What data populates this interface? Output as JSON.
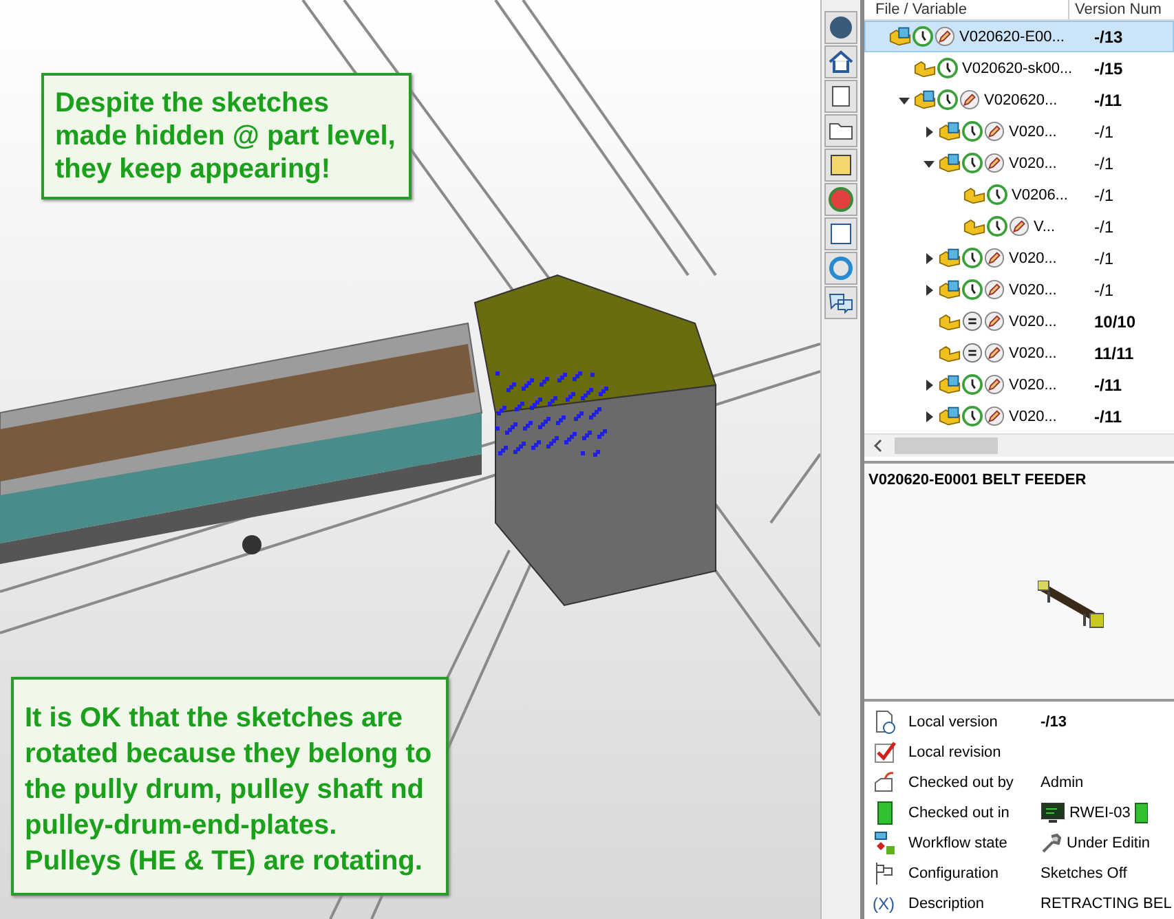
{
  "annotations": [
    {
      "text": "Despite the sketches\nmade hidden @ part level,\nthey keep appearing!"
    },
    {
      "text": "It is OK that the sketches are\nrotated because they belong to\nthe pully drum, pulley shaft nd\npulley-drum-end-plates.\nPulleys (HE & TE) are rotating."
    }
  ],
  "file_tree": {
    "columns": [
      "File / Variable",
      "Version Num"
    ],
    "items": [
      {
        "kind": "assembly",
        "local_only": true,
        "editable": true,
        "name": "V020620-E00...",
        "version": "-/13",
        "version_bold": true,
        "selected": true,
        "children": [
          {
            "kind": "part",
            "local_only": true,
            "editable": false,
            "name": "V020620-sk00...",
            "version": "-/15",
            "version_bold": true,
            "selected": false
          },
          {
            "kind": "assembly",
            "local_only": true,
            "editable": true,
            "name": "V020620...",
            "version": "-/11",
            "version_bold": true,
            "selected": false,
            "expanded": true,
            "children": [
              {
                "kind": "assembly",
                "local_only": true,
                "editable": true,
                "name": "V020...",
                "version": "-/1",
                "version_bold": false,
                "selected": false,
                "expanded": false
              },
              {
                "kind": "assembly",
                "local_only": true,
                "editable": true,
                "name": "V020...",
                "version": "-/1",
                "version_bold": false,
                "selected": false,
                "expanded": true,
                "children": [
                  {
                    "kind": "part",
                    "local_only": true,
                    "editable": false,
                    "name": "V0206...",
                    "version": "-/1",
                    "version_bold": false,
                    "selected": false
                  },
                  {
                    "kind": "part",
                    "local_only": true,
                    "editable": true,
                    "name": "V...",
                    "version": "-/1",
                    "version_bold": false,
                    "selected": false
                  }
                ]
              },
              {
                "kind": "assembly",
                "local_only": true,
                "editable": true,
                "name": "V020...",
                "version": "-/1",
                "version_bold": false,
                "selected": false,
                "expanded": false
              },
              {
                "kind": "assembly",
                "local_only": true,
                "editable": true,
                "name": "V020...",
                "version": "-/1",
                "version_bold": false,
                "selected": false,
                "expanded": false
              },
              {
                "kind": "part",
                "local_only": false,
                "editable": true,
                "name": "V020...",
                "version": "10/10",
                "version_bold": true,
                "selected": false
              },
              {
                "kind": "part",
                "local_only": false,
                "editable": true,
                "name": "V020...",
                "version": "11/11",
                "version_bold": true,
                "selected": false
              },
              {
                "kind": "assembly",
                "local_only": true,
                "editable": true,
                "name": "V020...",
                "version": "-/11",
                "version_bold": true,
                "selected": false,
                "expanded": false
              },
              {
                "kind": "assembly",
                "local_only": true,
                "editable": true,
                "name": "V020...",
                "version": "-/11",
                "version_bold": true,
                "selected": false,
                "expanded": false
              }
            ]
          }
        ]
      }
    ]
  },
  "preview": {
    "title": "V020620-E0001 BELT FEEDER"
  },
  "properties": [
    {
      "label": "Local version",
      "value": "-/13",
      "value_bold": true
    },
    {
      "label": "Local revision"
    },
    {
      "label": "Checked out by",
      "value": "Admin",
      "value_bold": false
    },
    {
      "label": "Checked out in",
      "value": "RWEI-03",
      "value_bold": false
    },
    {
      "label": "Workflow state",
      "value": "Under Editin",
      "value_bold": false
    },
    {
      "label": "Configuration",
      "value": "Sketches Off",
      "value_bold": false
    },
    {
      "label": "Description",
      "value": "RETRACTING BEL",
      "value_bold": false,
      "label_icon": "(X)"
    }
  ]
}
